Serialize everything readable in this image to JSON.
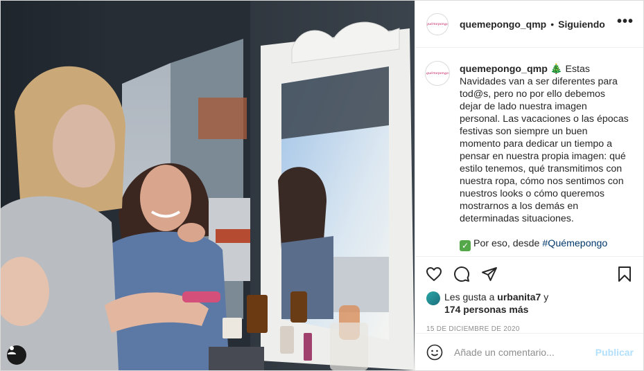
{
  "post": {
    "username": "quemepongo_qmp",
    "separator": "•",
    "follow_status": "Siguiendo",
    "more_label": "•••",
    "avatar_text": "quémepongo"
  },
  "caption": {
    "username": "quemepongo_qmp",
    "emoji": "🎄",
    "body": "Estas Navidades van a ser diferentes para tod@s, pero no por ello debemos dejar de lado nuestra imagen personal. Las vacaciones o las épocas festivas son siempre un buen momento para dedicar un tiempo a pensar en nuestra propia imagen: qué estilo tenemos, qué transmitimos con nuestra ropa, cómo nos sentimos con nuestros looks o cómo queremos mostrarnos a los demás en determinadas situaciones.",
    "check_emoji": "✓",
    "line2_text": "Por eso, desde",
    "hashtag": "#Quémepongo"
  },
  "actions": {
    "icons": [
      "heart-icon",
      "comment-icon",
      "share-icon",
      "bookmark-icon"
    ]
  },
  "likes": {
    "prefix": "Les gusta a",
    "user": "urbanita7",
    "connector": "y",
    "others": "174 personas más"
  },
  "date": "15 DE DICIEMBRE DE 2020",
  "comment": {
    "placeholder": "Añade un comentario...",
    "publish_label": "Publicar"
  },
  "colors": {
    "hashtag": "#00376b",
    "publish": "#b2dffc",
    "muted": "#8e8e8e",
    "border": "#dbdbdb"
  }
}
